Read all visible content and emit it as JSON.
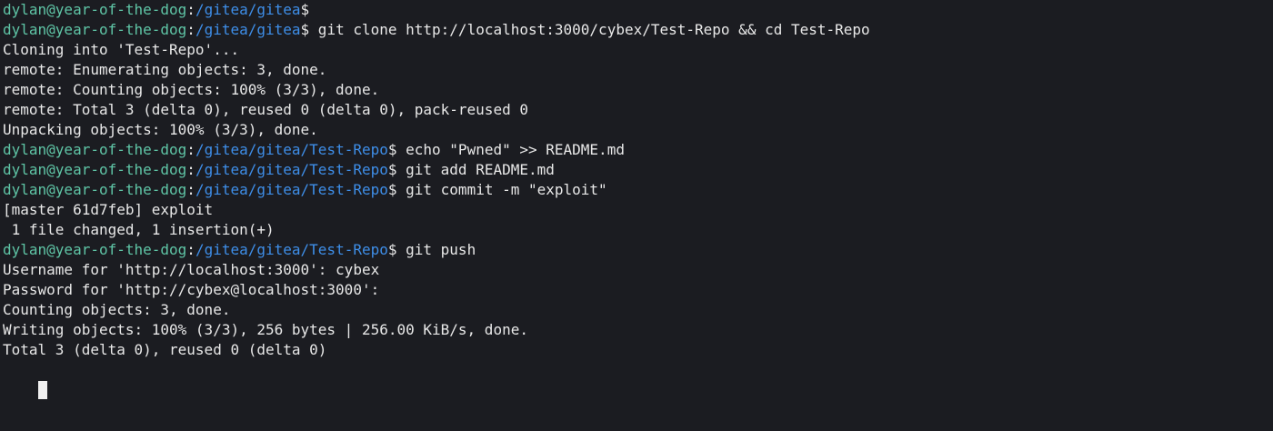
{
  "theme": {
    "background": "#1b1c21",
    "foreground": "#e8e8e8",
    "user_color": "#5fc5a6",
    "path_color": "#3e8ee8"
  },
  "terminal": {
    "lines": [
      {
        "kind": "prompt",
        "user": "dylan@year-of-the-dog",
        "sep": ":",
        "path": "/gitea/gitea",
        "symbol": "$",
        "cmd": ""
      },
      {
        "kind": "prompt",
        "user": "dylan@year-of-the-dog",
        "sep": ":",
        "path": "/gitea/gitea",
        "symbol": "$",
        "cmd": " git clone http://localhost:3000/cybex/Test-Repo && cd Test-Repo"
      },
      {
        "kind": "output",
        "text": "Cloning into 'Test-Repo'..."
      },
      {
        "kind": "output",
        "text": "remote: Enumerating objects: 3, done."
      },
      {
        "kind": "output",
        "text": "remote: Counting objects: 100% (3/3), done."
      },
      {
        "kind": "output",
        "text": "remote: Total 3 (delta 0), reused 0 (delta 0), pack-reused 0"
      },
      {
        "kind": "output",
        "text": "Unpacking objects: 100% (3/3), done."
      },
      {
        "kind": "prompt",
        "user": "dylan@year-of-the-dog",
        "sep": ":",
        "path": "/gitea/gitea/Test-Repo",
        "symbol": "$",
        "cmd": " echo \"Pwned\" >> README.md"
      },
      {
        "kind": "prompt",
        "user": "dylan@year-of-the-dog",
        "sep": ":",
        "path": "/gitea/gitea/Test-Repo",
        "symbol": "$",
        "cmd": " git add README.md"
      },
      {
        "kind": "prompt",
        "user": "dylan@year-of-the-dog",
        "sep": ":",
        "path": "/gitea/gitea/Test-Repo",
        "symbol": "$",
        "cmd": " git commit -m \"exploit\""
      },
      {
        "kind": "output",
        "text": "[master 61d7feb] exploit"
      },
      {
        "kind": "output",
        "text": " 1 file changed, 1 insertion(+)"
      },
      {
        "kind": "prompt",
        "user": "dylan@year-of-the-dog",
        "sep": ":",
        "path": "/gitea/gitea/Test-Repo",
        "symbol": "$",
        "cmd": " git push"
      },
      {
        "kind": "output",
        "text": "Username for 'http://localhost:3000': cybex"
      },
      {
        "kind": "output",
        "text": "Password for 'http://cybex@localhost:3000':"
      },
      {
        "kind": "output",
        "text": "Counting objects: 3, done."
      },
      {
        "kind": "output",
        "text": "Writing objects: 100% (3/3), 256 bytes | 256.00 KiB/s, done."
      },
      {
        "kind": "output",
        "text": "Total 3 (delta 0), reused 0 (delta 0)"
      }
    ]
  }
}
